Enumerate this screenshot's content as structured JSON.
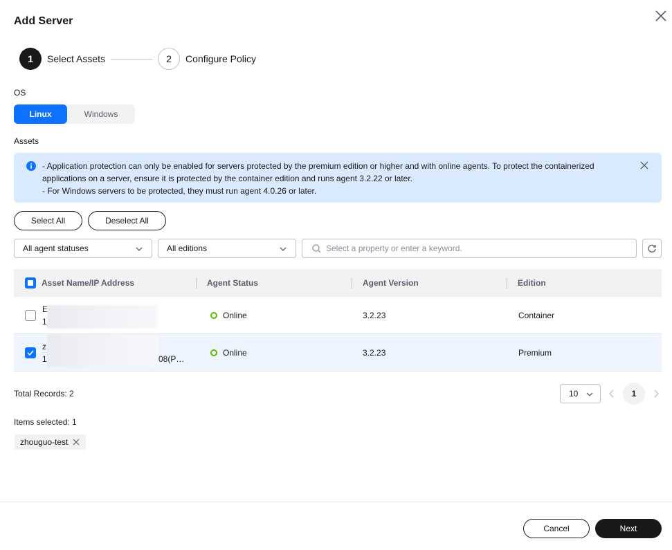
{
  "dialog": {
    "title": "Add Server"
  },
  "steps": [
    {
      "number": "1",
      "label": "Select Assets",
      "active": true
    },
    {
      "number": "2",
      "label": "Configure Policy",
      "active": false
    }
  ],
  "os": {
    "label": "OS",
    "options": [
      "Linux",
      "Windows"
    ],
    "selected": "Linux"
  },
  "assets": {
    "label": "Assets",
    "notice_lines": [
      "- Application protection can only be enabled for servers protected by the premium edition or higher and with online agents. To protect the containerized applications on a server, ensure it is protected by the container edition and runs agent 3.2.22 or later.",
      "- For Windows servers to be protected, they must run agent 4.0.26 or later."
    ]
  },
  "actions": {
    "select_all": "Select All",
    "deselect_all": "Deselect All"
  },
  "filters": {
    "agent_status": "All agent statuses",
    "edition": "All editions",
    "search_placeholder": "Select a property or enter a keyword."
  },
  "table": {
    "columns": [
      "Asset Name/IP Address",
      "Agent Status",
      "Agent Version",
      "Edition"
    ],
    "rows": [
      {
        "name_line1": "E",
        "name_line2": "1",
        "status": "Online",
        "version": "3.2.23",
        "edition": "Container",
        "checked": false
      },
      {
        "name_line1": "z",
        "name_line2": "1",
        "name_suffix": "08(P…",
        "status": "Online",
        "version": "3.2.23",
        "edition": "Premium",
        "checked": true
      }
    ]
  },
  "pagination": {
    "total": "Total Records: 2",
    "page_size": "10",
    "current_page": "1"
  },
  "selection": {
    "label": "Items selected: 1",
    "tags": [
      "zhouguo-test"
    ]
  },
  "footer": {
    "cancel": "Cancel",
    "next": "Next"
  },
  "colors": {
    "primary": "#0d72ff",
    "dark": "#191919",
    "online": "#5fb700",
    "notice_bg": "#d9eaff"
  },
  "icons": [
    "close-icon",
    "info-icon",
    "chevron-down-icon",
    "search-icon",
    "refresh-icon",
    "chevron-left-icon",
    "chevron-right-icon",
    "check-icon"
  ]
}
